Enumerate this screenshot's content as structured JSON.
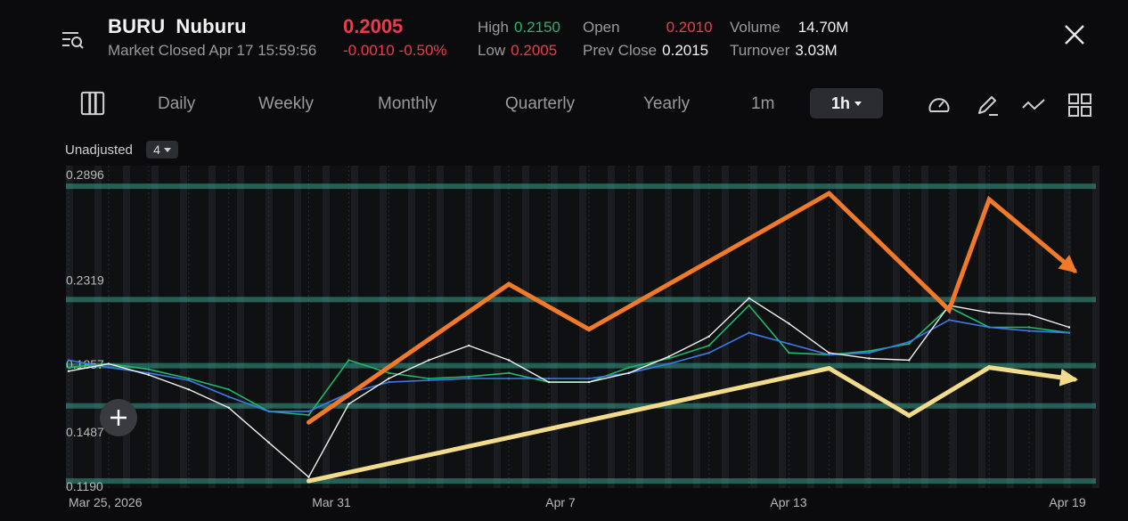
{
  "header": {
    "symbol": "BURU",
    "name": "Nuburu",
    "status": "Market Closed Apr 17 15:59:56",
    "price": "0.2005",
    "change": "-0.0010",
    "change_pct": "-0.50%",
    "stats": {
      "high_label": "High",
      "high": "0.2150",
      "low_label": "Low",
      "low": "0.2005",
      "open_label": "Open",
      "open": "0.2010",
      "prev_close_label": "Prev Close",
      "prev_close": "0.2015",
      "volume_label": "Volume",
      "volume": "14.70M",
      "turnover_label": "Turnover",
      "turnover": "3.03M"
    }
  },
  "icons": {
    "menu": "list-search-icon",
    "close": "close-icon",
    "layout": "panel-layout-icon",
    "speedometer": "speedometer-icon",
    "draw": "pen-icon",
    "indicator": "wave-line-icon",
    "grid": "grid-icon",
    "add": "plus-icon"
  },
  "toolbar": {
    "periods": [
      "Daily",
      "Weekly",
      "Monthly",
      "Quarterly",
      "Yearly",
      "1m"
    ],
    "selected": "1h"
  },
  "adjust": {
    "label": "Unadjusted",
    "value": "4"
  },
  "colors": {
    "background": "#0b0b0d",
    "price_line": "#1fb86a",
    "ma_fast": "#3b7be8",
    "ma_slow": "#f0f0f0",
    "resistance_trend": "#f07a2a",
    "support_trend": "#f2dc8c",
    "horizontal_levels": "#3fbfa8",
    "up": "#1fb86a",
    "down": "#f0394a"
  },
  "chart_data": {
    "type": "line",
    "title": "",
    "xlabel": "",
    "ylabel": "",
    "x_tick_labels": [
      "Mar 25, 2026",
      "Mar 31",
      "Apr 7",
      "Apr 13",
      "Apr 19"
    ],
    "y_tick_labels": [
      "0.2896",
      "0.2319",
      "0.1857",
      "0.1487",
      "0.1190"
    ],
    "ylim": [
      0.119,
      0.2896
    ],
    "grid": true,
    "series": [
      {
        "role": "price",
        "x": [
          "Mar 25",
          "Mar 26",
          "Mar 27",
          "Mar 28",
          "Mar 29",
          "Mar 30",
          "Mar 31",
          "Apr 1",
          "Apr 2",
          "Apr 3",
          "Apr 4",
          "Apr 5",
          "Apr 6",
          "Apr 7",
          "Apr 8",
          "Apr 9",
          "Apr 10",
          "Apr 11",
          "Apr 12",
          "Apr 13",
          "Apr 14",
          "Apr 15",
          "Apr 16",
          "Apr 17",
          "Apr 18",
          "Apr 19"
        ],
        "values": [
          0.184,
          0.186,
          0.183,
          0.178,
          0.172,
          0.16,
          0.158,
          0.188,
          0.181,
          0.178,
          0.179,
          0.181,
          0.176,
          0.176,
          0.184,
          0.189,
          0.196,
          0.218,
          0.192,
          0.191,
          0.193,
          0.197,
          0.217,
          0.206,
          0.206,
          0.203
        ]
      },
      {
        "role": "moving-average-fast",
        "x": [
          "Mar 25",
          "Mar 26",
          "Mar 27",
          "Mar 28",
          "Mar 29",
          "Mar 30",
          "Mar 31",
          "Apr 1",
          "Apr 2",
          "Apr 3",
          "Apr 4",
          "Apr 5",
          "Apr 6",
          "Apr 7",
          "Apr 8",
          "Apr 9",
          "Apr 10",
          "Apr 11",
          "Apr 12",
          "Apr 13",
          "Apr 14",
          "Apr 15",
          "Apr 16",
          "Apr 17",
          "Apr 18",
          "Apr 19"
        ],
        "values": [
          0.188,
          0.184,
          0.181,
          0.177,
          0.168,
          0.16,
          0.16,
          0.17,
          0.176,
          0.177,
          0.178,
          0.178,
          0.178,
          0.178,
          0.181,
          0.186,
          0.192,
          0.203,
          0.197,
          0.191,
          0.192,
          0.198,
          0.21,
          0.206,
          0.204,
          0.203
        ]
      },
      {
        "role": "moving-average-slow",
        "x": [
          "Mar 25",
          "Mar 26",
          "Mar 27",
          "Mar 28",
          "Mar 29",
          "Mar 30",
          "Mar 31",
          "Apr 1",
          "Apr 2",
          "Apr 3",
          "Apr 4",
          "Apr 5",
          "Apr 6",
          "Apr 7",
          "Apr 8",
          "Apr 9",
          "Apr 10",
          "Apr 11",
          "Apr 12",
          "Apr 13",
          "Apr 14",
          "Apr 15",
          "Apr 16",
          "Apr 17",
          "Apr 18",
          "Apr 19"
        ],
        "values": [
          0.182,
          0.186,
          0.18,
          0.172,
          0.162,
          0.143,
          0.124,
          0.164,
          0.178,
          0.188,
          0.196,
          0.188,
          0.176,
          0.176,
          0.181,
          0.19,
          0.201,
          0.222,
          0.208,
          0.192,
          0.189,
          0.188,
          0.218,
          0.214,
          0.213,
          0.206
        ]
      }
    ],
    "annotations": {
      "resistance_trend": {
        "points": [
          [
            "Mar 31",
            0.154
          ],
          [
            "Apr 5",
            0.2296
          ],
          [
            "Apr 7",
            0.2049
          ],
          [
            "Apr 13",
            0.2793
          ],
          [
            "Apr 16",
            0.2155
          ],
          [
            "Apr 17",
            0.276
          ],
          [
            "Apr 19",
            0.2369
          ]
        ]
      },
      "support_trend": {
        "points": [
          [
            "Mar 31",
            0.1219
          ],
          [
            "Apr 13",
            0.1836
          ],
          [
            "Apr 15",
            0.1577
          ],
          [
            "Apr 17",
            0.184
          ],
          [
            "Apr 19",
            0.1775
          ]
        ]
      },
      "horizontal_levels": [
        0.2832,
        0.2212,
        0.185,
        0.163,
        0.1219
      ]
    }
  }
}
